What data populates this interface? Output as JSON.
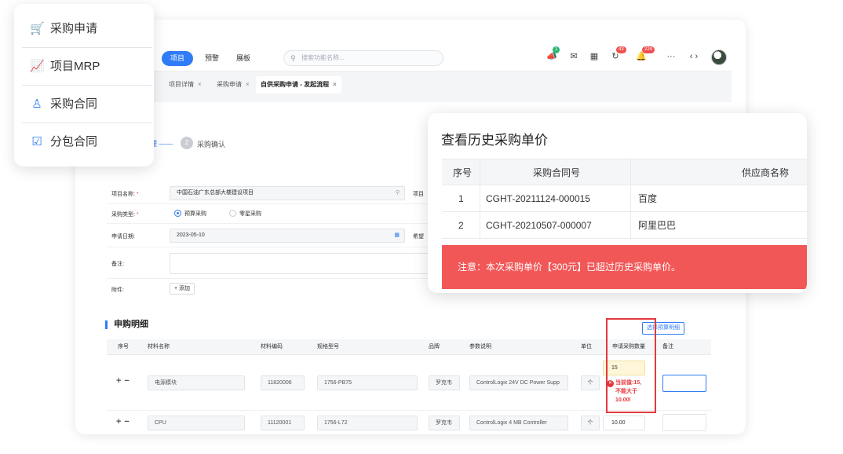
{
  "topbar": {
    "nav": [
      "项目",
      "预警",
      "展板"
    ],
    "search_placeholder": "搜索功能名称...",
    "badges": {
      "notify": "1",
      "sync": "43",
      "alerts": "224"
    },
    "more": "···",
    "code": "‹ ›"
  },
  "tabs": [
    {
      "label": "项目详情"
    },
    {
      "label": "采购申请"
    },
    {
      "label": "自供采购申请 - 发起流程"
    }
  ],
  "steps": {
    "step1_label": "理 ——",
    "step2_num": "2",
    "step2_label": "采购确认"
  },
  "form": {
    "project_name_label": "项目名称:",
    "project_name_value": "中国石油广东总部大楼建设项目",
    "project_right_label": "项目",
    "purchase_type_label": "采购类型:",
    "purchase_type_options": [
      "预算采购",
      "零星采购"
    ],
    "apply_date_label": "申请日期:",
    "apply_date_value": "2023-05-10",
    "hope_label": "希望",
    "remark_label": "备注:",
    "attachment_label": "附件:",
    "add_attachment": "+ 添加"
  },
  "detail": {
    "title": "申购明细",
    "select_budget_button": "选择预算明细",
    "columns": [
      "序号",
      "材料名称",
      "材料编码",
      "规格型号",
      "品牌",
      "参数说明",
      "单位",
      "申请采购数量",
      "备注"
    ],
    "rows": [
      {
        "name": "电源模块",
        "code": "11820006",
        "spec": "1756-PB75",
        "brand": "罗克韦",
        "param": "ControlLogix 24V DC Power Supp",
        "unit": "个",
        "qty": "15"
      },
      {
        "name": "CPU",
        "code": "11120001",
        "spec": "1756-L72",
        "brand": "罗克韦",
        "param": "ControlLogix 4 MB Controller",
        "unit": "个",
        "qty": "10.00"
      }
    ],
    "error_line1": "当前值:15,",
    "error_line2": "不能大于",
    "error_line3": "10.00!"
  },
  "side_menu": {
    "items": [
      {
        "label": "采购申请",
        "icon": "cart-icon"
      },
      {
        "label": "项目MRP",
        "icon": "chart-icon"
      },
      {
        "label": "采购合同",
        "icon": "person-icon"
      },
      {
        "label": "分包合同",
        "icon": "checklist-icon"
      }
    ]
  },
  "history_popup": {
    "title": "查看历史采购单价",
    "columns": [
      "序号",
      "采购合同号",
      "供应商名称"
    ],
    "rows": [
      {
        "no": "1",
        "contract": "CGHT-20211124-000015",
        "supplier": "百度"
      },
      {
        "no": "2",
        "contract": "CGHT-20210507-000007",
        "supplier": "阿里巴巴"
      }
    ],
    "alert": "注意：本次采购单价【300元】已超过历史采购单价。"
  },
  "colors": {
    "accent": "#2f7cf6",
    "danger": "#e4393c",
    "alert_bg": "#f25757"
  }
}
